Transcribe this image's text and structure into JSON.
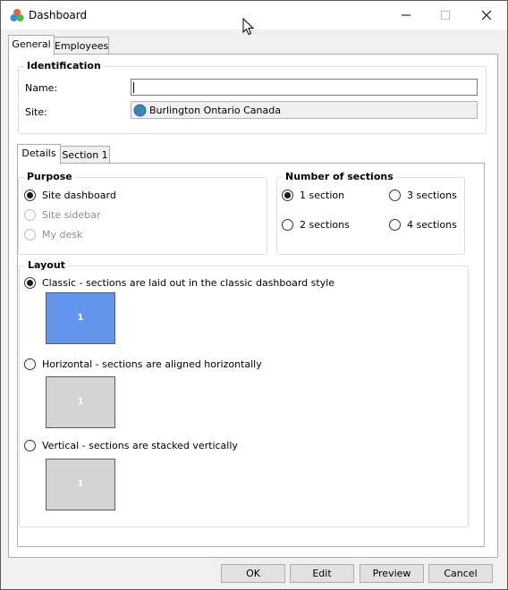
{
  "window": {
    "title": "Dashboard",
    "icon": "dashboard-app-icon"
  },
  "tabs": [
    {
      "label": "General",
      "active": true
    },
    {
      "label": "Employees",
      "active": false
    }
  ],
  "identification": {
    "title": "Identification",
    "name_label": "Name:",
    "name_value": "",
    "site_label": "Site:",
    "site_value": "Burlington Ontario Canada",
    "site_icon": "globe-icon"
  },
  "subtabs": [
    {
      "label": "Details",
      "active": true
    },
    {
      "label": "Section 1",
      "active": false
    }
  ],
  "purpose": {
    "title": "Purpose",
    "options": [
      {
        "label": "Site dashboard",
        "checked": true,
        "enabled": true
      },
      {
        "label": "Site sidebar",
        "checked": false,
        "enabled": false
      },
      {
        "label": "My desk",
        "checked": false,
        "enabled": false
      }
    ]
  },
  "sections": {
    "title": "Number of sections",
    "options": [
      {
        "label": "1 section",
        "checked": true
      },
      {
        "label": "3 sections",
        "checked": false
      },
      {
        "label": "2 sections",
        "checked": false
      },
      {
        "label": "4 sections",
        "checked": false
      }
    ]
  },
  "layout": {
    "title": "Layout",
    "options": [
      {
        "label": "Classic - sections are laid out in the classic dashboard style",
        "checked": true,
        "preview": "1"
      },
      {
        "label": "Horizontal - sections are aligned horizontally",
        "checked": false,
        "preview": "1"
      },
      {
        "label": "Vertical - sections are stacked vertically",
        "checked": false,
        "preview": "1"
      }
    ]
  },
  "buttons": {
    "ok": "OK",
    "edit": "Edit",
    "preview": "Preview",
    "cancel": "Cancel"
  },
  "colors": {
    "selected_preview": "#6495ed",
    "unselected_preview": "#d4d4d4"
  }
}
